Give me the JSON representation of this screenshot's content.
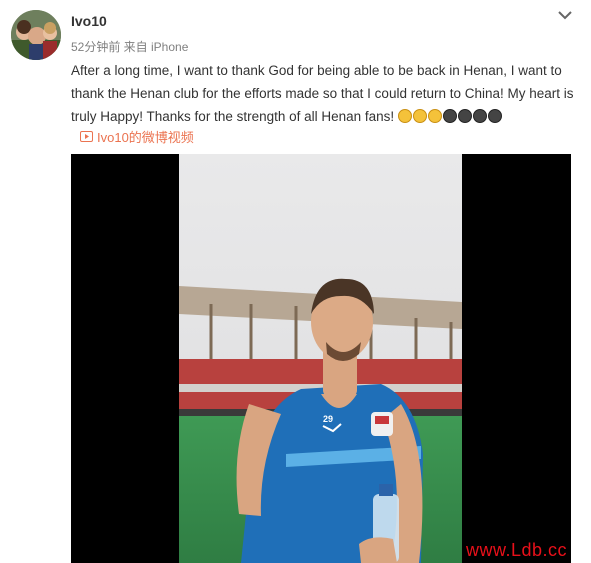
{
  "post": {
    "username": "Ivo10",
    "meta": "52分钟前 来自 iPhone",
    "text": "After a long time, I want to thank God for being able to be back in Henan, I want to thank the Henan club for the efforts made so that I could return to China!  My heart is truly Happy!  Thanks for the strength of all Henan fans!",
    "emojis": [
      "laughing-emoji",
      "laughing-emoji",
      "laughing-emoji",
      "crying-emoji",
      "crying-emoji",
      "crying-emoji",
      "crying-emoji"
    ],
    "video_link": "Ivo10的微博视频",
    "jersey_number": "29"
  },
  "watermark": "www.Ldb.cc",
  "colors": {
    "link": "#eb7350",
    "text": "#333333",
    "meta": "#808080",
    "watermark": "#e8101a",
    "jersey": "#1f6fb8"
  },
  "icons": {
    "menu": "chevron-down-icon",
    "video": "video-play-icon"
  }
}
